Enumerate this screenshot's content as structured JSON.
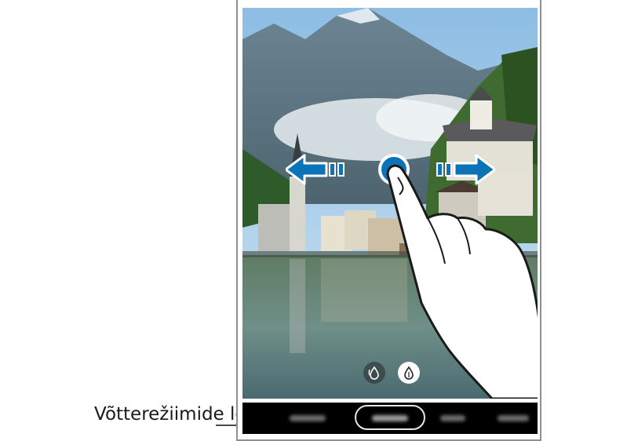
{
  "caption": {
    "label": "Võtterežiimide loend"
  },
  "scene": {
    "description_icon": "landscape-photo"
  },
  "gesture": {
    "type": "swipe-left-right",
    "icons": [
      "arrow-left-icon",
      "arrow-right-icon",
      "finger-tap-icon"
    ]
  },
  "camera_controls": {
    "icons": [
      "effect-off-icon",
      "effect-on-icon"
    ]
  },
  "mode_list": {
    "items": [
      "mode-1",
      "mode-2",
      "mode-3",
      "mode-4",
      "mode-5"
    ],
    "selected_index": 1
  },
  "colors": {
    "arrow_blue": "#0b73b8",
    "sky": "#8fc0e2",
    "mode_bar": "#000000"
  }
}
